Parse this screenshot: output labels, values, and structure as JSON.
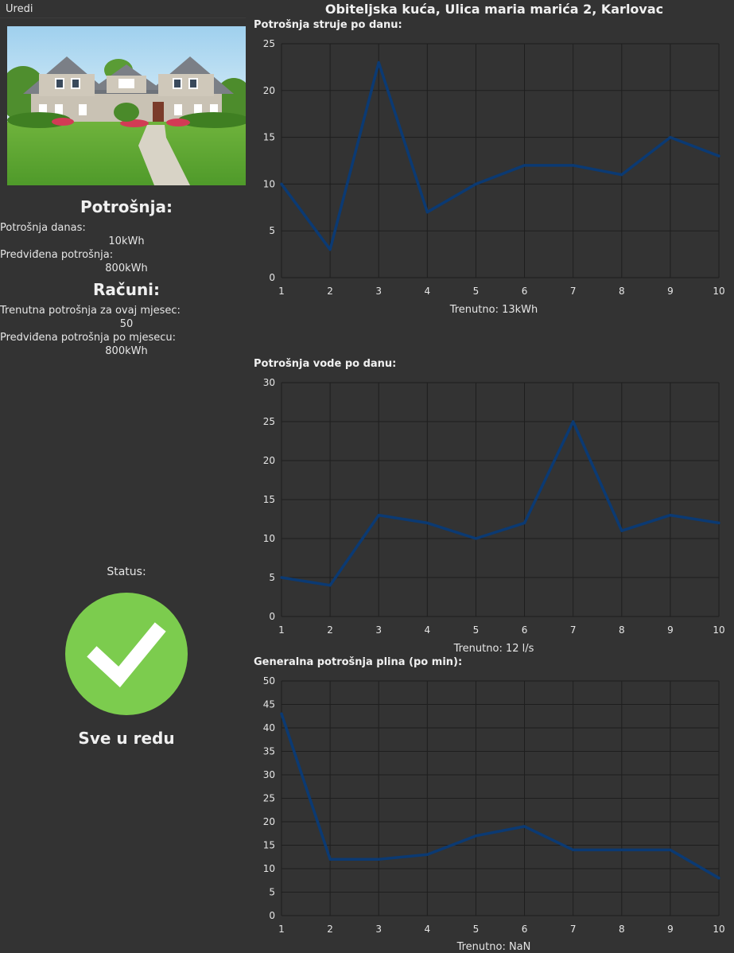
{
  "nav": {
    "edit_label": "Uredi"
  },
  "header": {
    "title": "Obiteljska kuća, Ulica maria marića 2, Karlovac"
  },
  "consumption": {
    "title": "Potrošnja:",
    "today_label": "Potrošnja danas:",
    "today_value": "10kWh",
    "predicted_label": "Predviđena potrošnja:",
    "predicted_value": "800kWh"
  },
  "bills": {
    "title": "Računi:",
    "current_label": "Trenutna potrošnja za ovaj mjesec:",
    "current_value": "50",
    "predicted_label": "Predviđena potrošnja po mjesecu:",
    "predicted_value": "800kWh"
  },
  "status": {
    "label": "Status:",
    "text": "Sve u redu",
    "icon": "checkmark-circle-icon",
    "color": "#7ccc4e"
  },
  "colors": {
    "background": "#333333",
    "line": "#0b3a73",
    "grid": "#1e1e1e"
  },
  "charts": {
    "electricity": {
      "title": "Potrošnja struje po danu:",
      "current": "Trenutno: 13kWh"
    },
    "water": {
      "title": "Potrošnja vode po danu:",
      "current": "Trenutno: 12 l/s"
    },
    "gas": {
      "title": "Generalna potrošnja plina (po min):",
      "current": "Trenutno: NaN"
    }
  },
  "chart_data": [
    {
      "type": "line",
      "title": "Potrošnja struje po danu:",
      "x": [
        1,
        2,
        3,
        4,
        5,
        6,
        7,
        8,
        9,
        10
      ],
      "y": [
        10,
        3,
        23,
        7,
        10,
        12,
        12,
        11,
        15,
        13
      ],
      "ylim": [
        0,
        25
      ],
      "yticks": [
        0,
        5,
        10,
        15,
        20,
        25
      ],
      "grid": true
    },
    {
      "type": "line",
      "title": "Potrošnja vode po danu:",
      "x": [
        1,
        2,
        3,
        4,
        5,
        6,
        7,
        8,
        9,
        10
      ],
      "y": [
        5,
        4,
        13,
        12,
        10,
        12,
        25,
        11,
        13,
        12
      ],
      "ylim": [
        0,
        30
      ],
      "yticks": [
        0,
        5,
        10,
        15,
        20,
        25,
        30
      ],
      "grid": true
    },
    {
      "type": "line",
      "title": "Generalna potrošnja plina (po min):",
      "x": [
        1,
        2,
        3,
        4,
        5,
        6,
        7,
        8,
        9,
        10
      ],
      "y": [
        43,
        12,
        12,
        13,
        17,
        19,
        14,
        14,
        14,
        8
      ],
      "ylim": [
        0,
        50
      ],
      "yticks": [
        0,
        5,
        10,
        15,
        20,
        25,
        30,
        35,
        40,
        45,
        50
      ],
      "grid": true
    }
  ]
}
